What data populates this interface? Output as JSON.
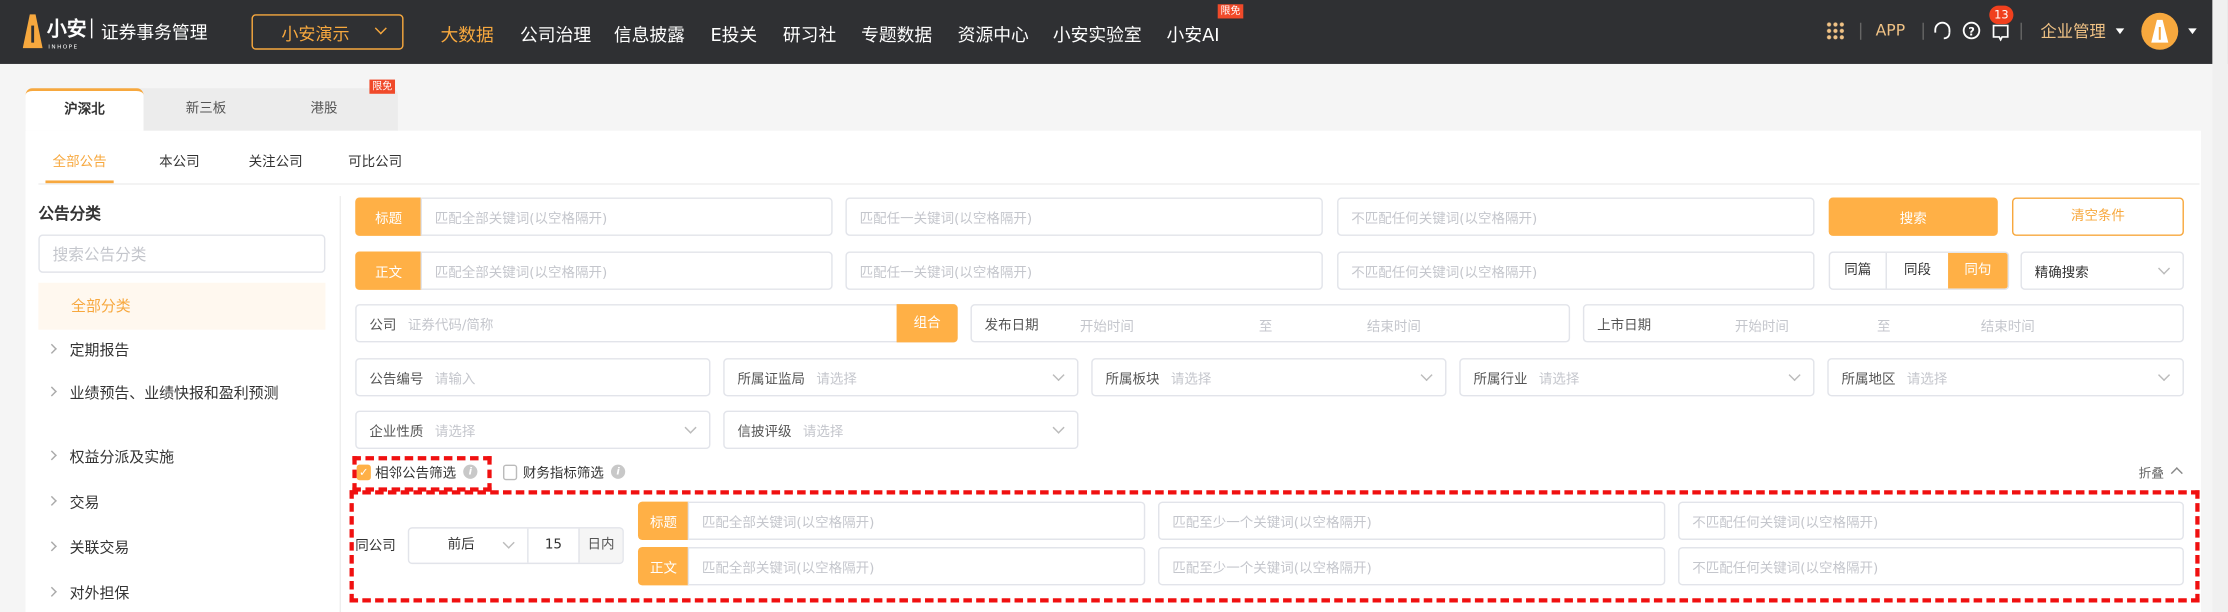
{
  "nav": {
    "logo_text": "小安",
    "logo_sub": "INHOPE",
    "product": "证券事务管理",
    "org_select": "小安演示",
    "items": [
      "大数据",
      "公司治理",
      "信息披露",
      "E投关",
      "研习社",
      "专题数据",
      "资源中心",
      "小安实验室",
      "小安AI"
    ],
    "ai_badge": "限免",
    "app": "APP",
    "msg_count": "13",
    "enterprise": "企业管理"
  },
  "market_tabs": {
    "items": [
      "沪深北",
      "新三板",
      "港股"
    ],
    "badge": "限免"
  },
  "sub_tabs": [
    "全部公告",
    "本公司",
    "关注公司",
    "可比公司"
  ],
  "sidebar": {
    "title": "公告分类",
    "search_placeholder": "搜索公告分类",
    "items": [
      "全部分类",
      "定期报告",
      "业绩预告、业绩快报和盈利预测",
      "权益分派及实施",
      "交易",
      "关联交易",
      "对外担保"
    ]
  },
  "search": {
    "title_label": "标题",
    "body_label": "正文",
    "ph_all": "匹配全部关键词(以空格隔开)",
    "ph_any": "匹配任一关键词(以空格隔开)",
    "ph_none": "不匹配任何关键词(以空格隔开)",
    "search_btn": "搜索",
    "clear_btn": "清空条件",
    "scope": [
      "同篇",
      "同段",
      "同句"
    ],
    "mode": "精确搜索"
  },
  "company": {
    "label": "公司",
    "placeholder": "证券代码/简称",
    "combo": "组合"
  },
  "publish_date": {
    "label": "发布日期",
    "start": "开始时间",
    "to": "至",
    "end": "结束时间"
  },
  "listing_date": {
    "label": "上市日期",
    "start": "开始时间",
    "to": "至",
    "end": "结束时间"
  },
  "filters": [
    {
      "label": "公告编号",
      "placeholder": "请输入"
    },
    {
      "label": "所属证监局",
      "placeholder": "请选择"
    },
    {
      "label": "所属板块",
      "placeholder": "请选择"
    },
    {
      "label": "所属行业",
      "placeholder": "请选择"
    },
    {
      "label": "所属地区",
      "placeholder": "请选择"
    },
    {
      "label": "企业性质",
      "placeholder": "请选择"
    },
    {
      "label": "信披评级",
      "placeholder": "请选择"
    }
  ],
  "checks": {
    "adjacent": "相邻公告筛选",
    "financial": "财务指标筛选",
    "info": "i"
  },
  "collapse": "折叠",
  "adjacent": {
    "same_company": "同公司",
    "direction": "前后",
    "days": "15",
    "unit": "日内",
    "title_label": "标题",
    "body_label": "正文",
    "ph_all": "匹配全部关键词(以空格隔开)",
    "ph_atleast": "匹配至少一个关键词(以空格隔开)",
    "ph_none": "不匹配任何关键词(以空格隔开)"
  }
}
